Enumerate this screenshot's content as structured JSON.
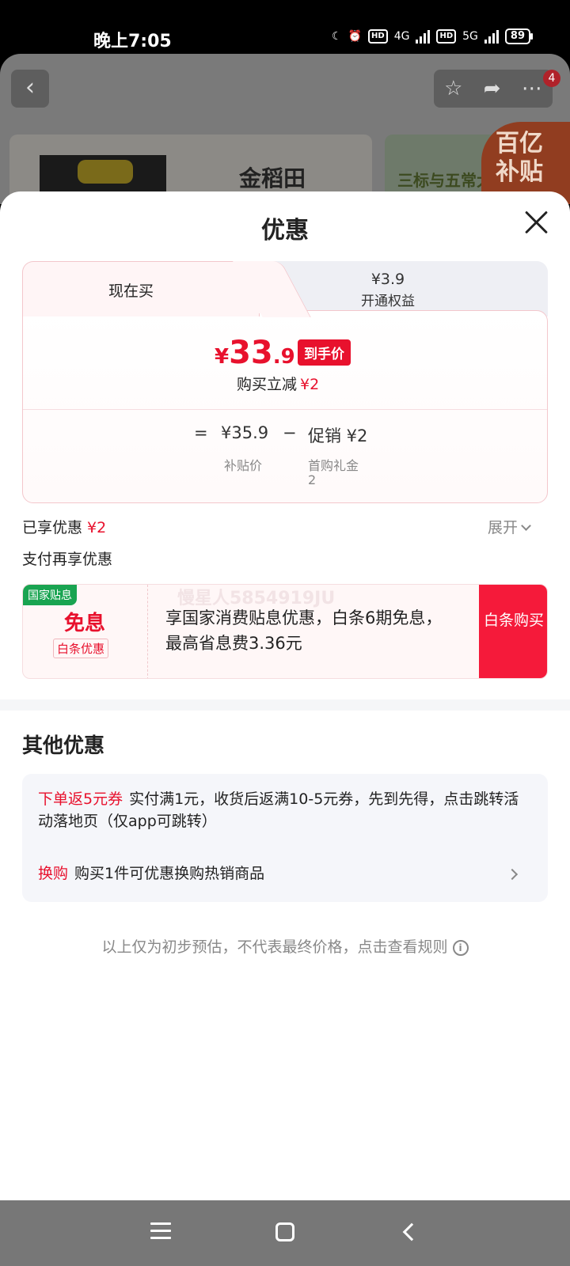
{
  "status_bar": {
    "time": "晚上7:05",
    "network_1": "4G",
    "network_2": "5G",
    "hd": "HD",
    "battery": "89"
  },
  "background_page": {
    "cart_badge": "4",
    "brand_text": "金稻田",
    "banner2_text": "三标与五常大米",
    "subsidy_line1": "百亿",
    "subsidy_line2": "补贴"
  },
  "sheet": {
    "title": "优惠",
    "tabs": [
      {
        "label": "现在买"
      },
      {
        "amount": "¥3.9",
        "label": "开通权益"
      }
    ],
    "final_price": {
      "yen": "¥",
      "int": "33",
      "dec": ".9",
      "tag": "到手价"
    },
    "reduce": {
      "label": "购买立减",
      "value": "¥2"
    },
    "calc": {
      "eq": "=",
      "subsidy_price": "¥35.9",
      "subsidy_label": "补贴价",
      "minus": "−",
      "promo": "促销 ¥2",
      "promo_label": "首购礼金",
      "promo_sub": "2"
    },
    "enjoyed": {
      "label": "已享优惠",
      "value": "¥2",
      "expand": "展开"
    },
    "pay_title": "支付再享优惠",
    "interest_free": {
      "tag": "国家贴息",
      "main": "免息",
      "sub": "白条优惠",
      "desc": "享国家消费贴息优惠，白条6期免息，最高省息费3.36元",
      "button": "白条购买",
      "watermark": "慢星人5854919JU"
    },
    "other": {
      "title": "其他优惠",
      "items": [
        {
          "tag": "下单返5元券",
          "text": "实付满1元，收货后返满10-5元券，先到先得，点击跳转活动落地页（仅app可跳转）"
        },
        {
          "tag": "换购",
          "text": "购买1件可优惠换购热销商品"
        }
      ]
    },
    "disclaimer": "以上仅为初步预估，不代表最终价格，点击查看规则",
    "info_icon": "i"
  }
}
